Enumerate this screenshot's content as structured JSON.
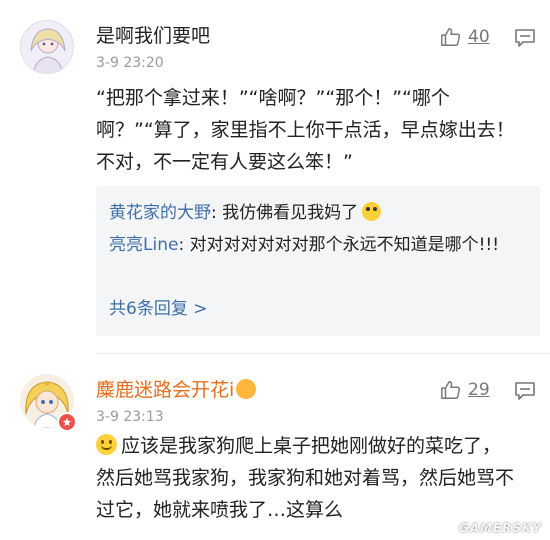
{
  "comments": [
    {
      "username": "是啊我们要吧",
      "time": "3-9 23:20",
      "likes": "40",
      "content": "“把那个拿过来！”“啥啊？”“那个！”“哪个啊？”“算了，家里指不上你干点活，早点嫁出去！不对，不一定有人要这么笨！”",
      "replies": [
        {
          "name": "黄花家的大野",
          "separator": ": ",
          "text": "我仿佛看见我妈了"
        },
        {
          "name": "亮亮Line",
          "separator": ": ",
          "text": "对对对对对对对那个永远不知道是哪个!!!"
        }
      ],
      "more_replies": "共6条回复 >"
    },
    {
      "username": "麋鹿迷路会开花i",
      "time": "3-9 23:13",
      "likes": "29",
      "content": "应该是我家狗爬上桌子把她刚做好的菜吃了，然后她骂我家狗，我家狗和她对着骂，然后她骂不过它，她就来喷我了…这算么"
    }
  ],
  "watermark": "GAMERSKY",
  "colors": {
    "link_blue": "#3f6fa6",
    "orange_name": "#e36f20",
    "time_gray": "#999999",
    "reply_bg": "#f4f5f7"
  },
  "icons": [
    "thumbs-up-icon",
    "reply-icon",
    "smiley-icon",
    "verified-badge-icon"
  ]
}
